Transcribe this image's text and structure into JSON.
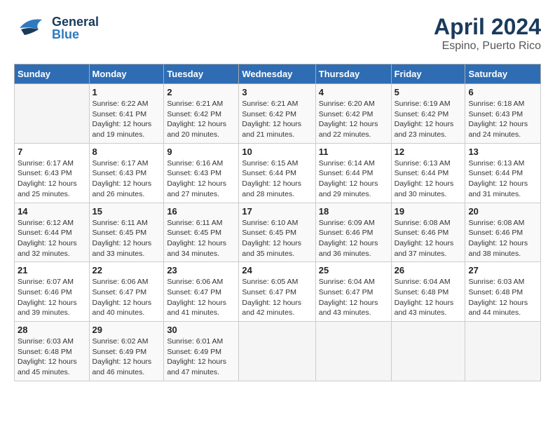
{
  "header": {
    "logo_general": "General",
    "logo_blue": "Blue",
    "month": "April 2024",
    "location": "Espino, Puerto Rico"
  },
  "days_of_week": [
    "Sunday",
    "Monday",
    "Tuesday",
    "Wednesday",
    "Thursday",
    "Friday",
    "Saturday"
  ],
  "weeks": [
    [
      {
        "day": "",
        "info": ""
      },
      {
        "day": "1",
        "info": "Sunrise: 6:22 AM\nSunset: 6:41 PM\nDaylight: 12 hours\nand 19 minutes."
      },
      {
        "day": "2",
        "info": "Sunrise: 6:21 AM\nSunset: 6:42 PM\nDaylight: 12 hours\nand 20 minutes."
      },
      {
        "day": "3",
        "info": "Sunrise: 6:21 AM\nSunset: 6:42 PM\nDaylight: 12 hours\nand 21 minutes."
      },
      {
        "day": "4",
        "info": "Sunrise: 6:20 AM\nSunset: 6:42 PM\nDaylight: 12 hours\nand 22 minutes."
      },
      {
        "day": "5",
        "info": "Sunrise: 6:19 AM\nSunset: 6:42 PM\nDaylight: 12 hours\nand 23 minutes."
      },
      {
        "day": "6",
        "info": "Sunrise: 6:18 AM\nSunset: 6:43 PM\nDaylight: 12 hours\nand 24 minutes."
      }
    ],
    [
      {
        "day": "7",
        "info": "Sunrise: 6:17 AM\nSunset: 6:43 PM\nDaylight: 12 hours\nand 25 minutes."
      },
      {
        "day": "8",
        "info": "Sunrise: 6:17 AM\nSunset: 6:43 PM\nDaylight: 12 hours\nand 26 minutes."
      },
      {
        "day": "9",
        "info": "Sunrise: 6:16 AM\nSunset: 6:43 PM\nDaylight: 12 hours\nand 27 minutes."
      },
      {
        "day": "10",
        "info": "Sunrise: 6:15 AM\nSunset: 6:44 PM\nDaylight: 12 hours\nand 28 minutes."
      },
      {
        "day": "11",
        "info": "Sunrise: 6:14 AM\nSunset: 6:44 PM\nDaylight: 12 hours\nand 29 minutes."
      },
      {
        "day": "12",
        "info": "Sunrise: 6:13 AM\nSunset: 6:44 PM\nDaylight: 12 hours\nand 30 minutes."
      },
      {
        "day": "13",
        "info": "Sunrise: 6:13 AM\nSunset: 6:44 PM\nDaylight: 12 hours\nand 31 minutes."
      }
    ],
    [
      {
        "day": "14",
        "info": "Sunrise: 6:12 AM\nSunset: 6:44 PM\nDaylight: 12 hours\nand 32 minutes."
      },
      {
        "day": "15",
        "info": "Sunrise: 6:11 AM\nSunset: 6:45 PM\nDaylight: 12 hours\nand 33 minutes."
      },
      {
        "day": "16",
        "info": "Sunrise: 6:11 AM\nSunset: 6:45 PM\nDaylight: 12 hours\nand 34 minutes."
      },
      {
        "day": "17",
        "info": "Sunrise: 6:10 AM\nSunset: 6:45 PM\nDaylight: 12 hours\nand 35 minutes."
      },
      {
        "day": "18",
        "info": "Sunrise: 6:09 AM\nSunset: 6:46 PM\nDaylight: 12 hours\nand 36 minutes."
      },
      {
        "day": "19",
        "info": "Sunrise: 6:08 AM\nSunset: 6:46 PM\nDaylight: 12 hours\nand 37 minutes."
      },
      {
        "day": "20",
        "info": "Sunrise: 6:08 AM\nSunset: 6:46 PM\nDaylight: 12 hours\nand 38 minutes."
      }
    ],
    [
      {
        "day": "21",
        "info": "Sunrise: 6:07 AM\nSunset: 6:46 PM\nDaylight: 12 hours\nand 39 minutes."
      },
      {
        "day": "22",
        "info": "Sunrise: 6:06 AM\nSunset: 6:47 PM\nDaylight: 12 hours\nand 40 minutes."
      },
      {
        "day": "23",
        "info": "Sunrise: 6:06 AM\nSunset: 6:47 PM\nDaylight: 12 hours\nand 41 minutes."
      },
      {
        "day": "24",
        "info": "Sunrise: 6:05 AM\nSunset: 6:47 PM\nDaylight: 12 hours\nand 42 minutes."
      },
      {
        "day": "25",
        "info": "Sunrise: 6:04 AM\nSunset: 6:47 PM\nDaylight: 12 hours\nand 43 minutes."
      },
      {
        "day": "26",
        "info": "Sunrise: 6:04 AM\nSunset: 6:48 PM\nDaylight: 12 hours\nand 43 minutes."
      },
      {
        "day": "27",
        "info": "Sunrise: 6:03 AM\nSunset: 6:48 PM\nDaylight: 12 hours\nand 44 minutes."
      }
    ],
    [
      {
        "day": "28",
        "info": "Sunrise: 6:03 AM\nSunset: 6:48 PM\nDaylight: 12 hours\nand 45 minutes."
      },
      {
        "day": "29",
        "info": "Sunrise: 6:02 AM\nSunset: 6:49 PM\nDaylight: 12 hours\nand 46 minutes."
      },
      {
        "day": "30",
        "info": "Sunrise: 6:01 AM\nSunset: 6:49 PM\nDaylight: 12 hours\nand 47 minutes."
      },
      {
        "day": "",
        "info": ""
      },
      {
        "day": "",
        "info": ""
      },
      {
        "day": "",
        "info": ""
      },
      {
        "day": "",
        "info": ""
      }
    ]
  ]
}
